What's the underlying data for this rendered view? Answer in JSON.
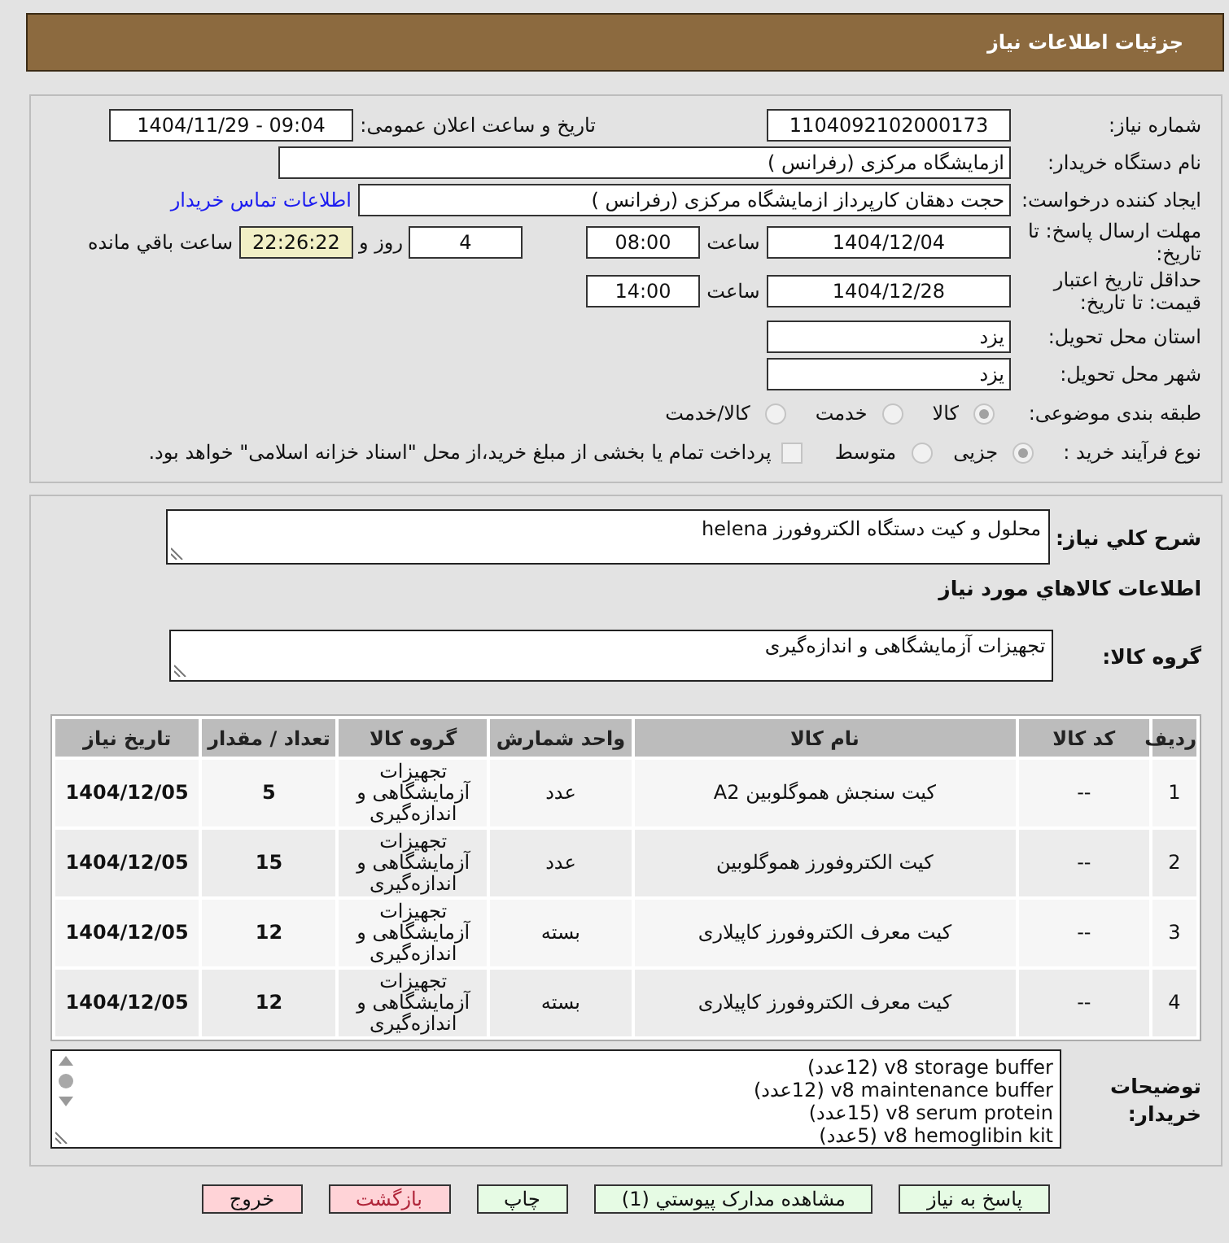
{
  "header": {
    "title": "جزئیات اطلاعات نیاز"
  },
  "need_number": {
    "label": "شماره نیاز:",
    "value": "1104092102000173"
  },
  "announcement": {
    "label": "تاریخ و ساعت اعلان عمومی:",
    "value": "1404/11/29 - 09:04"
  },
  "buyer_org": {
    "label": "نام دستگاه خریدار:",
    "value": "ازمایشگاه مرکزی (رفرانس )"
  },
  "requester": {
    "label": "ایجاد کننده درخواست:",
    "value": "حجت دهقان کارپرداز ازمایشگاه مرکزی (رفرانس )",
    "contact_link": "اطلاعات تماس خریدار"
  },
  "reply_deadline": {
    "label": "مهلت ارسال پاسخ: تا تاریخ:",
    "date": "1404/12/04",
    "time_label": "ساعت",
    "time": "08:00",
    "days": "4",
    "days_label": "روز و",
    "remaining": "22:26:22",
    "remaining_label": "ساعت باقي مانده"
  },
  "price_validity": {
    "label": "حداقل تاریخ اعتبار قیمت: تا تاریخ:",
    "date": "1404/12/28",
    "time_label": "ساعت",
    "time": "14:00"
  },
  "delivery_province": {
    "label": "استان محل تحویل:",
    "value": "یزد"
  },
  "delivery_city": {
    "label": "شهر محل تحویل:",
    "value": "یزد"
  },
  "category": {
    "label": "طبقه بندی موضوعی:",
    "options": [
      {
        "label": "کالا",
        "selected": true,
        "disabled": true
      },
      {
        "label": "خدمت",
        "selected": false,
        "disabled": true
      },
      {
        "label": "کالا/خدمت",
        "selected": false,
        "disabled": true
      }
    ]
  },
  "purchase_process": {
    "label": "نوع فرآیند خرید :",
    "options": [
      {
        "label": "جزیی",
        "selected": true,
        "disabled": true
      },
      {
        "label": "متوسط",
        "selected": false,
        "disabled": true
      }
    ],
    "treasury": {
      "label": "پرداخت تمام یا بخشی از مبلغ خرید،از محل \"اسناد خزانه اسلامی\" خواهد بود.",
      "checked": false,
      "disabled": true
    }
  },
  "description": {
    "label": "شرح کلي نياز:",
    "value": "محلول و کیت دستگاه الکتروفورز helena"
  },
  "goods_heading": "اطلاعات کالاهاي مورد نياز",
  "goods_group": {
    "label": "گروه کالا:",
    "value": "تجهیزات آزمایشگاهی و اندازه‌گیری"
  },
  "table": {
    "columns": [
      "ردیف",
      "کد کالا",
      "نام کالا",
      "واحد شمارش",
      "گروه کالا",
      "تعداد / مقدار",
      "تاریخ نیاز"
    ],
    "rows": [
      [
        "1",
        "--",
        "کیت سنجش هموگلوبین A2",
        "عدد",
        "تجهیزات آزمایشگاهی و اندازه‌گیری",
        "5",
        "1404/12/05"
      ],
      [
        "2",
        "--",
        "کیت الکتروفورز هموگلوبین",
        "عدد",
        "تجهیزات آزمایشگاهی و اندازه‌گیری",
        "15",
        "1404/12/05"
      ],
      [
        "3",
        "--",
        "کیت معرف الکتروفورز کاپیلاری",
        "بسته",
        "تجهیزات آزمایشگاهی و اندازه‌گیری",
        "12",
        "1404/12/05"
      ],
      [
        "4",
        "--",
        "کیت معرف الکتروفورز کاپیلاری",
        "بسته",
        "تجهیزات آزمایشگاهی و اندازه‌گیری",
        "12",
        "1404/12/05"
      ]
    ]
  },
  "buyer_notes": {
    "label": "توضیحات خریدار:",
    "lines": [
      "v8 storage buffer (12عدد)",
      "v8 maintenance buffer (12عدد)",
      "v8 serum protein (15عدد)",
      "v8 hemoglibin kit (5عدد)"
    ]
  },
  "buttons": [
    {
      "label": "پاسخ به نیاز",
      "kind": "reply"
    },
    {
      "label": "مشاهده مدارک پیوستي (1)",
      "kind": "attachments"
    },
    {
      "label": "چاپ",
      "kind": "print"
    },
    {
      "label": "بازگشت",
      "kind": "back"
    },
    {
      "label": "خروج",
      "kind": "exit"
    }
  ]
}
